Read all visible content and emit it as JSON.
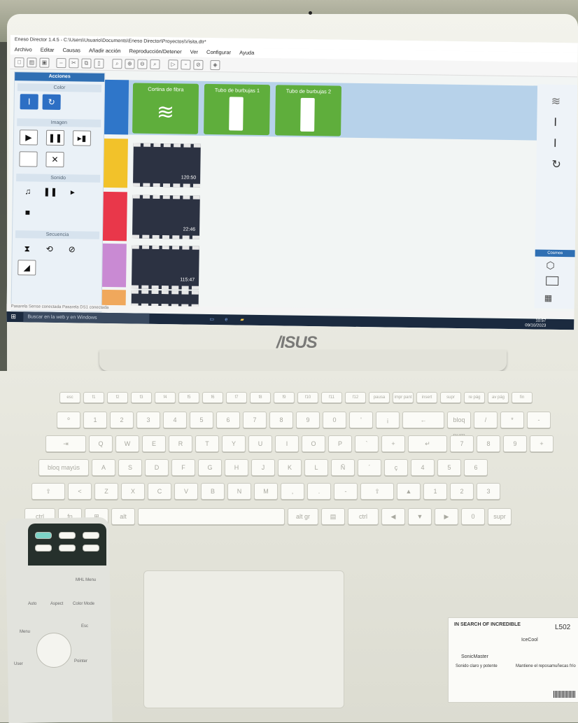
{
  "window": {
    "title": "Eneso Director 1.4.5 - C:\\Users\\Usuario\\Documents\\Eneso Director\\Proyectos\\Visita.dtr*",
    "menu": [
      "Archivo",
      "Editar",
      "Causas",
      "Añadir acción",
      "Reproducción/Detener",
      "Ver",
      "Configurar",
      "Ayuda"
    ]
  },
  "left_panel": {
    "title": "Acciones",
    "sections": [
      "Color",
      "Imagen",
      "Sonido",
      "Secuencia"
    ]
  },
  "devices": [
    {
      "label": "Cortina de fibra"
    },
    {
      "label": "Tubo de burbujas 1"
    },
    {
      "label": "Tubo de burbujas 2"
    }
  ],
  "rows": [
    {
      "color": "#2f76c9"
    },
    {
      "color": "#f2c22a",
      "clip_time": "120:50"
    },
    {
      "color": "#e9374a",
      "clip_time": "22:46"
    },
    {
      "color": "#c98ad3",
      "clip_time": "115:47"
    },
    {
      "color": "#f0a85c"
    }
  ],
  "right_panel": {
    "section": "Cosmos"
  },
  "status_bar": "Pasarela Sense conectada     Pasarela DS1 conectada",
  "taskbar": {
    "search_placeholder": "Buscar en la web y en Windows",
    "time": "10:57",
    "date": "09/10/2023"
  },
  "brand": "/ISUS",
  "keyboard": {
    "rows": [
      [
        "esc",
        "f1",
        "f2",
        "f3",
        "f4",
        "f5",
        "f6",
        "f7",
        "f8",
        "f9",
        "f10",
        "f11",
        "f12",
        "pausa",
        "impr pant",
        "insert",
        "supr",
        "re pág",
        "av pág",
        "fin"
      ],
      [
        "º",
        "1",
        "2",
        "3",
        "4",
        "5",
        "6",
        "7",
        "8",
        "9",
        "0",
        "'",
        "¡",
        "←",
        "bloq num",
        "/",
        "*",
        "-"
      ],
      [
        "⇥",
        "Q",
        "W",
        "E",
        "R",
        "T",
        "Y",
        "U",
        "I",
        "O",
        "P",
        "`",
        "+",
        "↵",
        "7",
        "8",
        "9",
        "+"
      ],
      [
        "bloq mayús",
        "A",
        "S",
        "D",
        "F",
        "G",
        "H",
        "J",
        "K",
        "L",
        "Ñ",
        "´",
        "ç",
        "4",
        "5",
        "6"
      ],
      [
        "⇧",
        "<",
        "Z",
        "X",
        "C",
        "V",
        "B",
        "N",
        "M",
        ",",
        ".",
        "-",
        "⇧",
        "▲",
        "1",
        "2",
        "3"
      ],
      [
        "ctrl",
        "fn",
        "⊞",
        "alt",
        "",
        "alt gr",
        "▤",
        "ctrl",
        "◀",
        "▼",
        "▶",
        "0",
        "supr"
      ]
    ]
  },
  "remote": {
    "labels": [
      "Auto",
      "Aspect",
      "Color Mode",
      "MHL Menu",
      "Menu",
      "Esc",
      "User",
      "Pointer"
    ]
  },
  "sticker": {
    "line1": "IN SEARCH OF INCREDIBLE",
    "product1": "SonicMaster",
    "tagline1": "Sonido claro y potente",
    "product2": "IceCool",
    "tagline2": "Mantiene el reposamuñecas frío",
    "model": "L502"
  }
}
